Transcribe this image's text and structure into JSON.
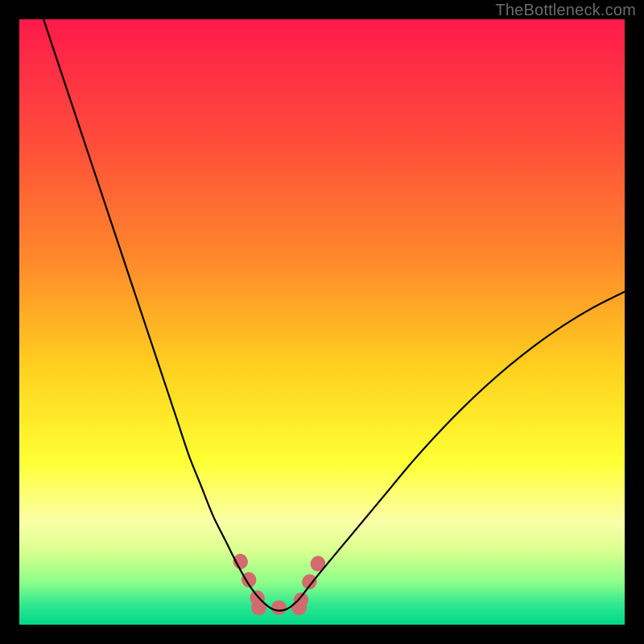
{
  "watermark": "TheBottleneck.com",
  "chart_data": {
    "type": "line",
    "title": "",
    "xlabel": "",
    "ylabel": "",
    "xlim": [
      0,
      100
    ],
    "ylim": [
      0,
      100
    ],
    "gradient_stops": [
      {
        "offset": 0.0,
        "color": "#ff1a4b"
      },
      {
        "offset": 0.2,
        "color": "#ff4c3a"
      },
      {
        "offset": 0.4,
        "color": "#ff8a2a"
      },
      {
        "offset": 0.58,
        "color": "#ffd21f"
      },
      {
        "offset": 0.73,
        "color": "#ffff33"
      },
      {
        "offset": 0.83,
        "color": "#fbffa8"
      },
      {
        "offset": 0.88,
        "color": "#d8ff8e"
      },
      {
        "offset": 0.93,
        "color": "#8dff89"
      },
      {
        "offset": 0.965,
        "color": "#33e98f"
      },
      {
        "offset": 1.0,
        "color": "#00d88a"
      }
    ],
    "series": [
      {
        "name": "bottleneck-curve",
        "x": [
          4,
          6,
          8,
          10,
          12,
          14,
          16,
          18,
          20,
          22,
          24,
          26,
          28,
          30,
          32,
          34,
          36,
          38,
          40,
          42,
          44,
          46,
          48,
          50,
          55,
          60,
          65,
          70,
          75,
          80,
          85,
          90,
          95,
          100
        ],
        "y": [
          100,
          94,
          88,
          82,
          76,
          70,
          64,
          58,
          52,
          46,
          40,
          34,
          28,
          23,
          18,
          14,
          10,
          6.5,
          4,
          2.5,
          2.5,
          4,
          6.5,
          9,
          15,
          21,
          27,
          32.5,
          37.5,
          42,
          46,
          49.5,
          52.5,
          55
        ]
      }
    ],
    "highlight_segments": [
      {
        "name": "left-marker",
        "color": "#d36a6e",
        "width": 18,
        "points": [
          {
            "x": 36.5,
            "y": 10.5
          },
          {
            "x": 39.5,
            "y": 4.0
          }
        ]
      },
      {
        "name": "bottom-marker",
        "color": "#d36a6e",
        "width": 18,
        "points": [
          {
            "x": 39.5,
            "y": 2.8
          },
          {
            "x": 46.5,
            "y": 2.8
          }
        ]
      },
      {
        "name": "right-marker",
        "color": "#d36a6e",
        "width": 18,
        "points": [
          {
            "x": 46.5,
            "y": 4.0
          },
          {
            "x": 49.5,
            "y": 10.5
          }
        ]
      }
    ]
  }
}
